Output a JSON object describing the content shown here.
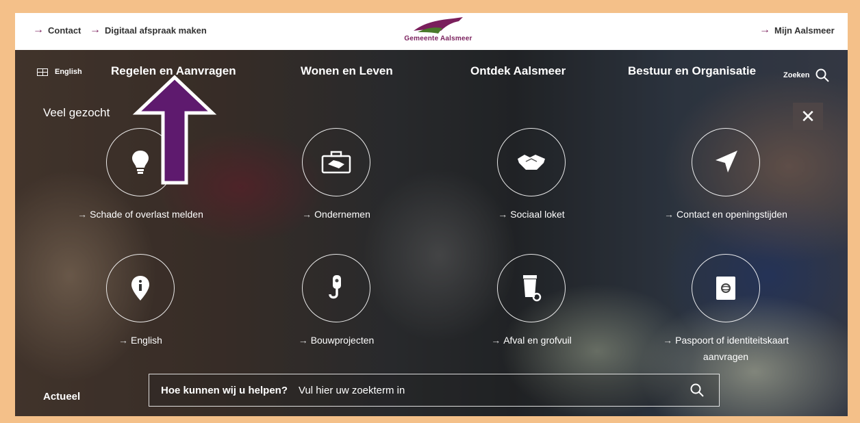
{
  "top": {
    "contact": "Contact",
    "appointment": "Digitaal afspraak maken",
    "my": "Mijn Aalsmeer",
    "logo_text": "Gemeente Aalsmeer"
  },
  "nav": {
    "language": "English",
    "items": [
      "Regelen en Aanvragen",
      "Wonen en Leven",
      "Ontdek Aalsmeer",
      "Bestuur en Organisatie"
    ],
    "search": "Zoeken"
  },
  "popular": {
    "title": "Veel gezocht",
    "close": "✕",
    "tiles": [
      {
        "label": "Schade of overlast melden",
        "icon": "lightbulb-icon"
      },
      {
        "label": "Ondernemen",
        "icon": "briefcase-icon"
      },
      {
        "label": "Sociaal loket",
        "icon": "handshake-icon"
      },
      {
        "label": "Contact en openingstijden",
        "icon": "navigation-arrow-icon"
      },
      {
        "label": "English",
        "icon": "info-pin-icon"
      },
      {
        "label": "Bouwprojecten",
        "icon": "crane-hook-icon"
      },
      {
        "label": "Afval en grofvuil",
        "icon": "waste-bin-icon"
      },
      {
        "label": "Paspoort of identiteitskaart aanvragen",
        "icon": "passport-icon"
      }
    ]
  },
  "search": {
    "label": "Hoe kunnen wij u helpen?",
    "placeholder": "Vul hier uw zoekterm in"
  },
  "footer": {
    "news": "Actueel"
  },
  "colors": {
    "brand": "#7a1f5c",
    "frame": "#f4c089",
    "arrow": "#5e1a6e"
  }
}
